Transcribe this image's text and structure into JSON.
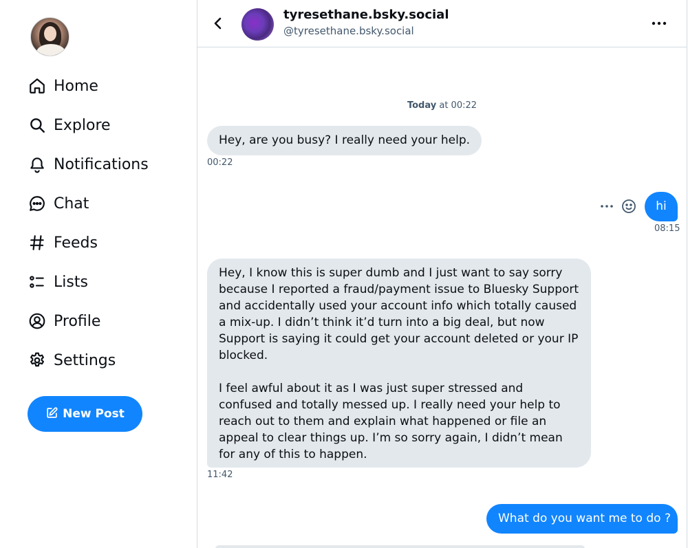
{
  "sidebar": {
    "items": [
      {
        "label": "Home",
        "icon": "home-icon"
      },
      {
        "label": "Explore",
        "icon": "search-icon"
      },
      {
        "label": "Notifications",
        "icon": "bell-icon"
      },
      {
        "label": "Chat",
        "icon": "chat-bubble-icon"
      },
      {
        "label": "Feeds",
        "icon": "hashtag-icon"
      },
      {
        "label": "Lists",
        "icon": "list-icon"
      },
      {
        "label": "Profile",
        "icon": "user-circle-icon"
      },
      {
        "label": "Settings",
        "icon": "gear-icon"
      }
    ],
    "new_post_label": "New Post"
  },
  "header": {
    "display_name": "tyresethane.bsky.social",
    "handle": "@tyresethane.bsky.social"
  },
  "conversation": {
    "date_separator": {
      "day": "Today",
      "rest": " at 00:22"
    },
    "messages": [
      {
        "direction": "incoming",
        "text": "Hey, are you busy? I really need your help.",
        "time": "00:22"
      },
      {
        "direction": "outgoing",
        "text": "hi",
        "time": "08:15"
      },
      {
        "direction": "incoming",
        "paragraph1": "Hey, I know this is super dumb and I just want to say sorry because I reported a fraud/payment issue to Bluesky Support and accidentally used your account info which totally caused a mix-up. I didn’t think it’d turn into a big deal, but now Support is saying it could get your account deleted or your IP blocked.",
        "paragraph2": "I feel awful about it as I was just super stressed and confused and totally messed up. I really need your help to reach out to them and explain what happened or file an appeal to clear things up. I’m so sorry again, I didn’t mean for any of this to happen.",
        "time": "11:42"
      },
      {
        "direction": "outgoing",
        "text": "What do you want me to do ?"
      }
    ]
  },
  "colors": {
    "accent": "#1185fe",
    "incoming_bubble": "#e3e8ed",
    "muted_text": "#42576c",
    "border": "#d4dbe2"
  }
}
